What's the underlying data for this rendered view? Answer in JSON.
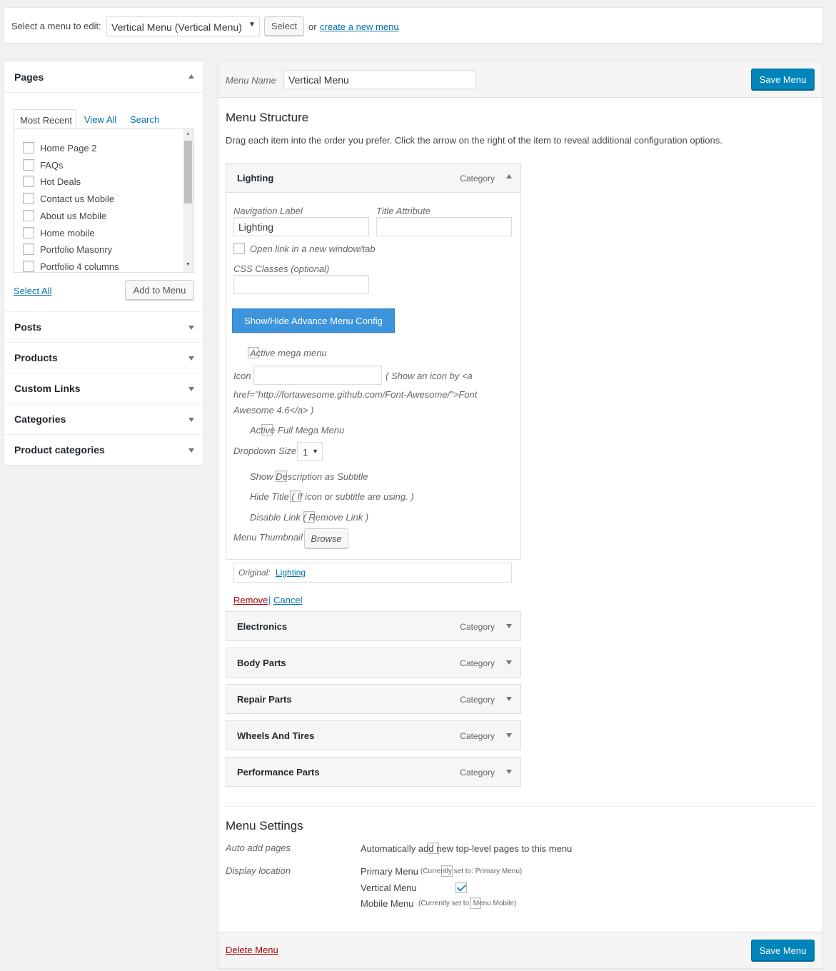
{
  "topbar": {
    "select_label": "Select a menu to edit:",
    "selected_menu": "Vertical Menu (Vertical Menu)",
    "select_button": "Select",
    "or_text": "or",
    "create_link": "create a new menu",
    "period": "."
  },
  "sidebar": {
    "pages": {
      "title": "Pages",
      "tabs": [
        "Most Recent",
        "View All",
        "Search"
      ],
      "items": [
        "Home Page 2",
        "FAQs",
        "Hot Deals",
        "Contact us Mobile",
        "About us Mobile",
        "Home mobile",
        "Portfolio Masonry",
        "Portfolio 4 columns"
      ],
      "select_all": "Select All",
      "add_button": "Add to Menu"
    },
    "sections": [
      "Posts",
      "Products",
      "Custom Links",
      "Categories",
      "Product categories"
    ]
  },
  "editor": {
    "menu_name_label": "Menu Name",
    "menu_name_value": "Vertical Menu",
    "save_button": "Save Menu",
    "structure_title": "Menu Structure",
    "structure_desc": "Drag each item into the order you prefer. Click the arrow on the right of the item to reveal additional configuration options.",
    "open_item": {
      "name": "Lighting",
      "type": "Category",
      "nav_label_title": "Navigation Label",
      "nav_label_value": "Lighting",
      "title_attr_title": "Title Attribute",
      "title_attr_value": "",
      "open_new_tab": "Open link in a new window/tab",
      "css_classes_title": "CSS Classes (optional)",
      "css_classes_value": "",
      "advance_button": "Show/Hide Advance Menu Config",
      "active_mega": "Active mega menu",
      "icon_label": "Icon",
      "icon_help_1": "( Show an icon by <a",
      "icon_help_2": "href=\"http://fortawesome.github.com/Font-Awesome/\">Font",
      "icon_help_3": "Awesome 4.6</a> )",
      "active_full_mega": "Active Full Mega Menu",
      "dropdown_size_label": "Dropdown Size",
      "dropdown_size_value": "1",
      "show_desc": "Show Description as Subtitle",
      "hide_title": "Hide Title ( If icon or subtitle are using. )",
      "disable_link": "Disable Link ( Remove Link )",
      "thumbnail_label": "Menu Thumbnail",
      "browse_button": "Browse",
      "original_label": "Original:",
      "original_link": "Lighting",
      "remove_link": "Remove",
      "separator": "|",
      "cancel_link": "Cancel"
    },
    "items": [
      {
        "name": "Electronics",
        "type": "Category"
      },
      {
        "name": "Body Parts",
        "type": "Category"
      },
      {
        "name": "Repair Parts",
        "type": "Category"
      },
      {
        "name": "Wheels And Tires",
        "type": "Category"
      },
      {
        "name": "Performance Parts",
        "type": "Category"
      }
    ],
    "settings": {
      "title": "Menu Settings",
      "auto_add_label": "Auto add pages",
      "auto_add_text": "Automatically add new top-level pages to this menu",
      "display_location_label": "Display location",
      "locations": [
        {
          "name": "Primary Menu",
          "note": "(Currently set to: Primary Menu)",
          "checked": false
        },
        {
          "name": "Vertical Menu",
          "note": "",
          "checked": true
        },
        {
          "name": "Mobile Menu",
          "note": "(Currently set to: Menu Mobile)",
          "checked": false
        }
      ]
    },
    "delete_link": "Delete Menu"
  },
  "colors": {
    "primary": "#0085ba",
    "advance_button": "#3c94dc",
    "link": "#0073aa",
    "delete": "#a00"
  }
}
